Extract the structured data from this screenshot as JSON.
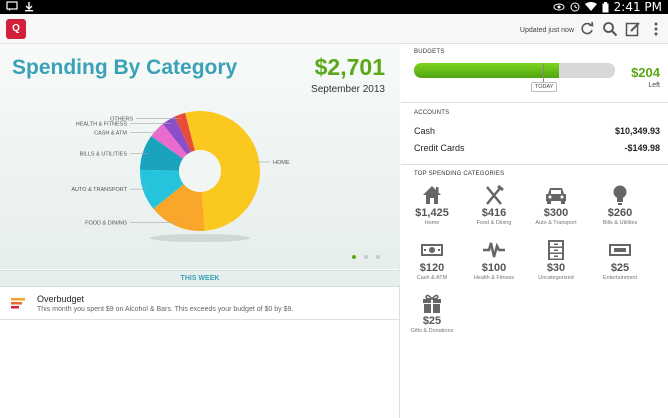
{
  "status_bar": {
    "time": "2:41 PM"
  },
  "action_bar": {
    "logo_text": "Q",
    "updated_text": "Updated just now"
  },
  "spending": {
    "title": "Spending By Category",
    "total": "$2,701",
    "period": "September 2013"
  },
  "chart_data": {
    "type": "pie",
    "slices": [
      {
        "label": "HOME",
        "value": 1425,
        "color": "#fbc81f"
      },
      {
        "label": "FOOD & DINING",
        "value": 416,
        "color": "#f9a62b"
      },
      {
        "label": "AUTO & TRANSPORT",
        "value": 300,
        "color": "#25c4dc"
      },
      {
        "label": "BILLS & UTILITIES",
        "value": 260,
        "color": "#1aa3bc"
      },
      {
        "label": "CASH & ATM",
        "value": 120,
        "color": "#ea6bd0"
      },
      {
        "label": "HEALTH & FITNESS",
        "value": 100,
        "color": "#8c4fc8"
      },
      {
        "label": "OTHERS",
        "value": 80,
        "color": "#e84b3a"
      }
    ]
  },
  "this_week": {
    "label": "THIS WEEK",
    "notice_title": "Overbudget",
    "notice_body": "This month you spent $9 on Alcohol & Bars. This exceeds your budget of $0 by $9."
  },
  "budgets": {
    "title": "BUDGETS",
    "progress": 0.72,
    "today_label": "TODAY",
    "amount": "$204",
    "left_label": "Left"
  },
  "accounts": {
    "title": "ACCOUNTS",
    "items": [
      {
        "name": "Cash",
        "value": "$10,349.93"
      },
      {
        "name": "Credit Cards",
        "value": "-$149.98"
      }
    ]
  },
  "top_categories": {
    "title": "TOP SPENDING CATEGORIES",
    "items": [
      {
        "amount": "$1,425",
        "label": "Home",
        "icon": "home-icon"
      },
      {
        "amount": "$416",
        "label": "Food & Dining",
        "icon": "fork-knife-icon"
      },
      {
        "amount": "$300",
        "label": "Auto & Transport",
        "icon": "car-icon"
      },
      {
        "amount": "$260",
        "label": "Bills & Utilities",
        "icon": "lightbulb-icon"
      },
      {
        "amount": "$120",
        "label": "Cash & ATM",
        "icon": "cash-icon"
      },
      {
        "amount": "$100",
        "label": "Health & Fitness",
        "icon": "heartbeat-icon"
      },
      {
        "amount": "$30",
        "label": "Uncategorized",
        "icon": "file-cabinet-icon"
      },
      {
        "amount": "$25",
        "label": "Entertainment",
        "icon": "ticket-icon"
      },
      {
        "amount": "$25",
        "label": "Gifts & Donations",
        "icon": "gift-icon"
      }
    ]
  }
}
